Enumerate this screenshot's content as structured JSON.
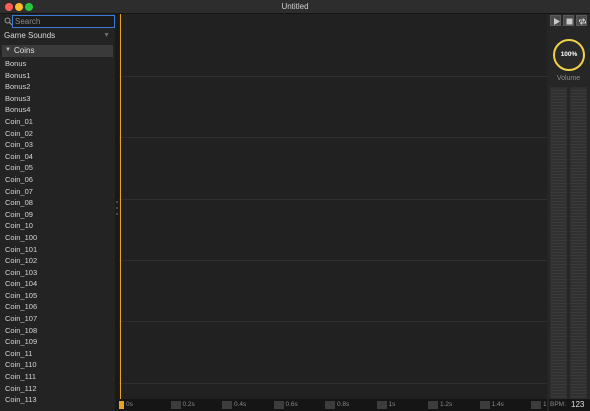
{
  "window": {
    "title": "Untitled"
  },
  "search": {
    "placeholder": "Search",
    "value": ""
  },
  "library": {
    "selected": "Game Sounds"
  },
  "group": {
    "label": "Coins",
    "expanded": true
  },
  "sounds": [
    "Bonus",
    "Bonus1",
    "Bonus2",
    "Bonus3",
    "Bonus4",
    "Coin_01",
    "Coin_02",
    "Coin_03",
    "Coin_04",
    "Coin_05",
    "Coin_06",
    "Coin_07",
    "Coin_08",
    "Coin_09",
    "Coin_10",
    "Coin_100",
    "Coin_101",
    "Coin_102",
    "Coin_103",
    "Coin_104",
    "Coin_105",
    "Coin_106",
    "Coin_107",
    "Coin_108",
    "Coin_109",
    "Coin_11",
    "Coin_110",
    "Coin_111",
    "Coin_112",
    "Coin_113"
  ],
  "ruler": {
    "ticks": [
      "0s",
      "0.2s",
      "0.4s",
      "0.6s",
      "0.8s",
      "1s",
      "1.2s",
      "1.4s",
      "1.6s"
    ]
  },
  "transport": {
    "play": "play-icon",
    "stop": "stop-icon",
    "loop": "loop-icon"
  },
  "volume": {
    "value": "100%",
    "label": "Volume"
  },
  "bpm": {
    "label": "BPM:",
    "value": "123"
  },
  "colors": {
    "accent": "#f0d24a",
    "playhead": "#e8a21c",
    "search_focus": "#3a7bd5"
  }
}
